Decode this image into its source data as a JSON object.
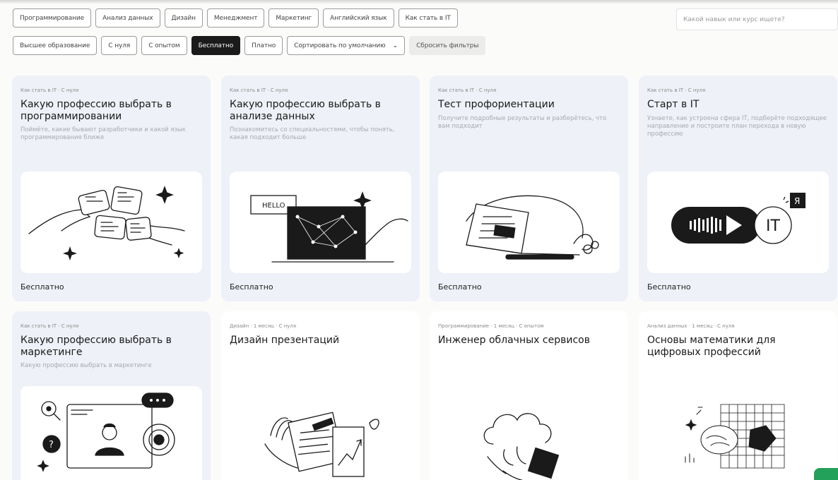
{
  "filters": {
    "row1": [
      "Программирование",
      "Анализ данных",
      "Дизайн",
      "Менеджмент",
      "Маркетинг",
      "Английский язык",
      "Как стать в IT"
    ],
    "row2_chips": [
      "Высшее образование",
      "С нуля",
      "С опытом"
    ],
    "active_chip": "Бесплатно",
    "paid_chip": "Платно",
    "sort_select": "Сортировать по умолчанию",
    "reset_button": "Сбросить фильтры"
  },
  "search": {
    "placeholder": "Какой навык или курс ищете?"
  },
  "cards": [
    {
      "meta": "Как стать в IT · С нуля",
      "title": "Какую профессию выбрать в программировании",
      "description": "Поймёте, какие бывают разработчики и какой язык программирования ближе",
      "price": "Бесплатно",
      "icon": "hands-holding-code-cards-icon"
    },
    {
      "meta": "Как стать в IT · С нуля",
      "title": "Какую профессию выбрать в анализе данных",
      "description": "Познакомитесь со специальностями, чтобы понять, какая подходит больше",
      "price": "Бесплатно",
      "icon": "hello-laptop-network-icon",
      "hello_text": "HELLO"
    },
    {
      "meta": "Как стать в IT · С нуля",
      "title": "Тест профориентации",
      "description": "Получите подробные результаты и разберётесь, что вам подходит",
      "price": "Бесплатно",
      "icon": "laptop-with-plant-icon"
    },
    {
      "meta": "Как стать в IT · С нуля",
      "title": "Старт в IT",
      "description": "Узнаете, как устроена сфера IT, подберёте подходящее направление и построите план перехода в новую профессию",
      "price": "Бесплатно",
      "icon": "play-it-badge-icon",
      "badge_text": "IT",
      "badge_letter": "Я"
    },
    {
      "meta": "Как стать в IT · С нуля",
      "title": "Какую профессию выбрать в маркетинге",
      "description": "Какую профессию выбрать в маркетинге",
      "icon": "marketing-profile-target-icon"
    },
    {
      "meta": "Дизайн · 1 месяц · С нуля",
      "title": "Дизайн презентаций",
      "icon": "hands-presentation-slides-icon"
    },
    {
      "meta": "Программирование · 1 месяц · С опытом",
      "title": "Инженер облачных сервисов",
      "icon": "cloud-hand-icon"
    },
    {
      "meta": "Анализ данных · 1 месяц · С нуля",
      "title": "Основы математики для цифровых профессий",
      "icon": "math-grid-globe-icon"
    }
  ],
  "colors": {
    "card_tinted": "#eef1f7",
    "card_white": "#ffffff",
    "active_chip": "#1b1b1b",
    "badge": "#23a05a"
  }
}
